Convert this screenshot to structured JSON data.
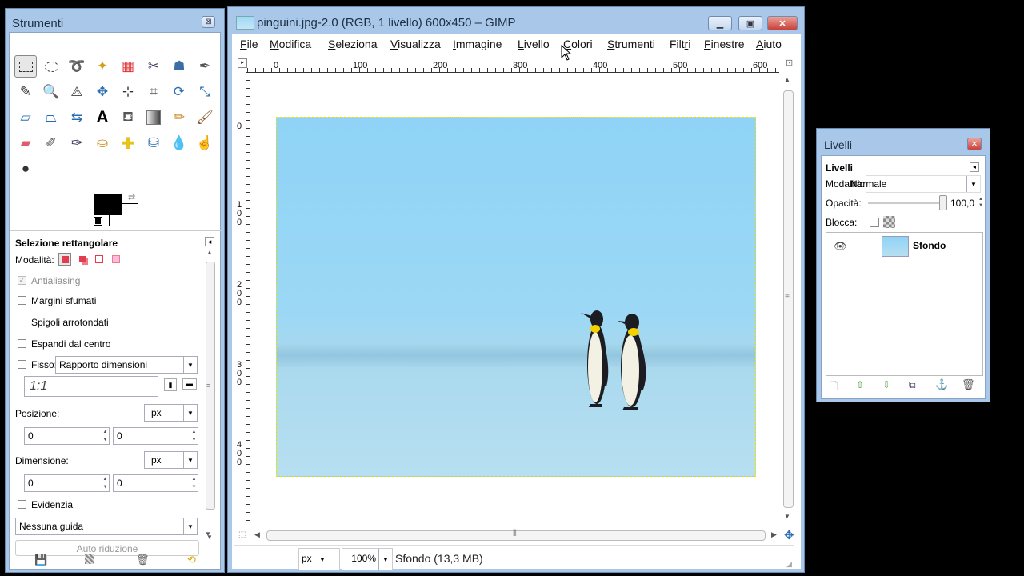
{
  "toolbox": {
    "title": "Strumenti",
    "tool_options_title": "Selezione rettangolare",
    "mode_label": "Modalità:",
    "antialiasing_label": "Antialiasing",
    "feather_label": "Margini sfumati",
    "rounded_label": "Spigoli arrotondati",
    "expand_label": "Espandi dal centro",
    "fixed_label": "Fisso:",
    "fixed_option": "Rapporto dimensioni",
    "ratio_value": "1:1",
    "position_label": "Posizione:",
    "position_unit": "px",
    "position_x": "0",
    "position_y": "0",
    "size_label": "Dimensione:",
    "size_unit": "px",
    "size_w": "0",
    "size_h": "0",
    "highlight_label": "Evidenzia",
    "guides_option": "Nessuna guida",
    "autoshrink_label": "Auto riduzione"
  },
  "gimp": {
    "title": "pinguini.jpg-2.0 (RGB, 1 livello) 600x450 – GIMP",
    "menu": [
      {
        "label": "File",
        "key": "F"
      },
      {
        "label": "Modifica",
        "key": "M"
      },
      {
        "label": "Seleziona",
        "key": "S"
      },
      {
        "label": "Visualizza",
        "key": "V"
      },
      {
        "label": "Immagine",
        "key": "I"
      },
      {
        "label": "Livello",
        "key": "L"
      },
      {
        "label": "Colori",
        "key": "C"
      },
      {
        "label": "Strumenti",
        "key": "S"
      },
      {
        "label": "Filtri",
        "key": "r"
      },
      {
        "label": "Finestre",
        "key": "F"
      },
      {
        "label": "Aiuto",
        "key": "A"
      }
    ],
    "hruler": [
      "0",
      "100",
      "200",
      "300",
      "400",
      "500",
      "600"
    ],
    "vruler": [
      "0",
      "100",
      "200",
      "300",
      "400"
    ],
    "status_unit": "px",
    "zoom": "100%",
    "status_text": "Sfondo (13,3 MB)"
  },
  "layers": {
    "title": "Livelli",
    "tab_label": "Livelli",
    "mode_label": "Modalità:",
    "mode_value": "Normale",
    "opacity_label": "Opacità:",
    "opacity_value": "100,0",
    "opacity_fraction": 1.0,
    "lock_label": "Blocca:",
    "layer_name": "Sfondo"
  },
  "colors": {
    "window_frame": "#a9c7e8",
    "sky_top": "#8fd3f6",
    "sky_bottom": "#b7dff1",
    "close_red": "#c9413a"
  }
}
